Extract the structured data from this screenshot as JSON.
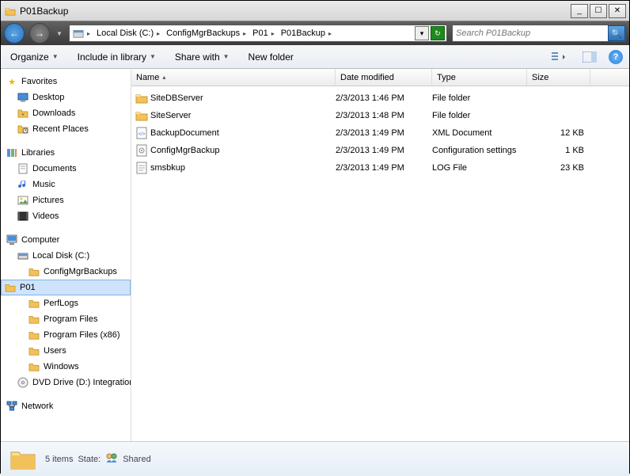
{
  "window": {
    "title": "P01Backup"
  },
  "breadcrumbs": [
    {
      "label": "Local Disk (C:)"
    },
    {
      "label": "ConfigMgrBackups"
    },
    {
      "label": "P01"
    },
    {
      "label": "P01Backup"
    }
  ],
  "search": {
    "placeholder": "Search P01Backup"
  },
  "toolbar": {
    "organize": "Organize",
    "include": "Include in library",
    "share": "Share with",
    "newfolder": "New folder"
  },
  "tree": {
    "favorites": {
      "label": "Favorites",
      "items": [
        "Desktop",
        "Downloads",
        "Recent Places"
      ]
    },
    "libraries": {
      "label": "Libraries",
      "items": [
        "Documents",
        "Music",
        "Pictures",
        "Videos"
      ]
    },
    "computer": {
      "label": "Computer",
      "localdisk": "Local Disk (C:)",
      "localdisk_children": [
        "ConfigMgrBackups",
        "PerfLogs",
        "Program Files",
        "Program Files (x86)",
        "Users",
        "Windows"
      ],
      "cmb_child": "P01",
      "dvd": "DVD Drive (D:) Integration"
    },
    "network": {
      "label": "Network"
    }
  },
  "columns": {
    "name": "Name",
    "date": "Date modified",
    "type": "Type",
    "size": "Size"
  },
  "files": [
    {
      "icon": "folder",
      "name": "SiteDBServer",
      "date": "2/3/2013 1:46 PM",
      "type": "File folder",
      "size": ""
    },
    {
      "icon": "folder",
      "name": "SiteServer",
      "date": "2/3/2013 1:48 PM",
      "type": "File folder",
      "size": ""
    },
    {
      "icon": "xml",
      "name": "BackupDocument",
      "date": "2/3/2013 1:49 PM",
      "type": "XML Document",
      "size": "12 KB"
    },
    {
      "icon": "ini",
      "name": "ConfigMgrBackup",
      "date": "2/3/2013 1:49 PM",
      "type": "Configuration settings",
      "size": "1 KB"
    },
    {
      "icon": "log",
      "name": "smsbkup",
      "date": "2/3/2013 1:49 PM",
      "type": "LOG File",
      "size": "23 KB"
    }
  ],
  "status": {
    "count": "5 items",
    "state_label": "State:",
    "state_value": "Shared"
  }
}
